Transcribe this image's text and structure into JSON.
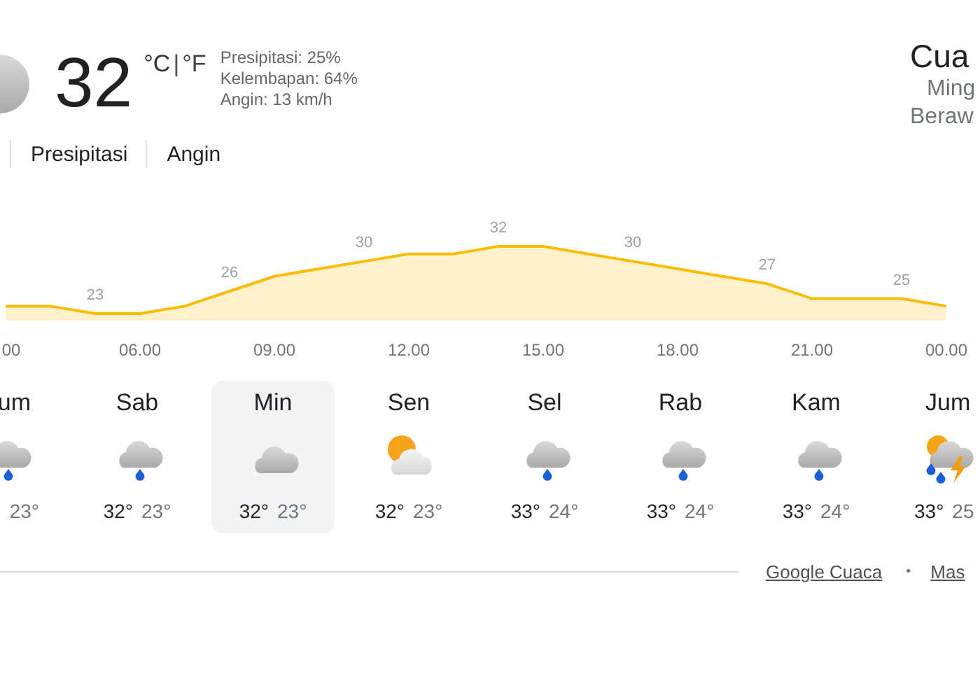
{
  "current": {
    "kind": "cloudy",
    "temperature": "32",
    "unit_celsius": "°C",
    "unit_separator": "|",
    "unit_fahrenheit": "°F",
    "details": [
      "Presipitasi: 25%",
      "Kelembapan: 64%",
      "Angin: 13 km/h"
    ]
  },
  "location": {
    "title": "Cua",
    "day": "Ming",
    "condition": "Beraw"
  },
  "tabs": [
    {
      "label": "Presipitasi",
      "selected": false
    },
    {
      "label": "Angin",
      "selected": false
    }
  ],
  "hourly": {
    "temperature_labels": [
      "23",
      "26",
      "30",
      "32",
      "30",
      "27",
      "25"
    ],
    "time_labels": [
      "00",
      "06.00",
      "09.00",
      "12.00",
      "15.00",
      "18.00",
      "21.00",
      "00.00"
    ]
  },
  "days": [
    {
      "day": "um",
      "kind": "rain",
      "low": "23°",
      "selected": false
    },
    {
      "day": "Sab",
      "kind": "rain",
      "high": "32°",
      "low": "23°",
      "selected": false
    },
    {
      "day": "Min",
      "kind": "cloudy",
      "high": "32°",
      "low": "23°",
      "selected": true
    },
    {
      "day": "Sen",
      "kind": "partly-cloudy",
      "high": "32°",
      "low": "23°",
      "selected": false
    },
    {
      "day": "Sel",
      "kind": "rain",
      "high": "33°",
      "low": "24°",
      "selected": false
    },
    {
      "day": "Rab",
      "kind": "rain",
      "high": "33°",
      "low": "24°",
      "selected": false
    },
    {
      "day": "Kam",
      "kind": "rain",
      "high": "33°",
      "low": "24°",
      "selected": false
    },
    {
      "day": "Jum",
      "kind": "storm",
      "high": "33°",
      "low": "25",
      "selected": false
    }
  ],
  "footer": {
    "links": [
      "Google Cuaca",
      "Mas"
    ],
    "separator": "•"
  }
}
